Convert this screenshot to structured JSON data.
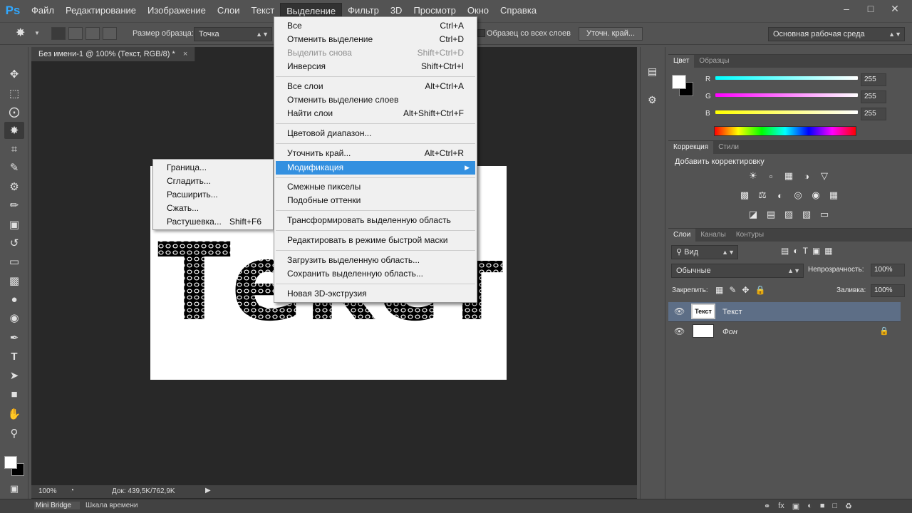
{
  "menubar": {
    "logo": "Ps",
    "items": [
      "Файл",
      "Редактирование",
      "Изображение",
      "Слои",
      "Текст",
      "Выделение",
      "Фильтр",
      "3D",
      "Просмотр",
      "Окно",
      "Справка"
    ]
  },
  "optbar": {
    "sample_size_label": "Размер образца:",
    "sample_size_value": "Точка",
    "all_layers_label": "Образец со всех слоев",
    "refine_button": "Уточн. край...",
    "workspace": "Основная рабочая среда"
  },
  "document": {
    "tab_title": "Без имени-1 @ 100% (Текст, RGB/8) *",
    "canvas_text": "Текст"
  },
  "statusbar": {
    "zoom": "100%",
    "doc_info": "Док: 439,5K/762,9K"
  },
  "bottombar": {
    "tabs": [
      "Mini Bridge",
      "Шкала времени"
    ]
  },
  "color_panel": {
    "tabs": [
      "Цвет",
      "Образцы"
    ],
    "channels": [
      {
        "label": "R",
        "value": "255"
      },
      {
        "label": "G",
        "value": "255"
      },
      {
        "label": "B",
        "value": "255"
      }
    ],
    "colors": {
      "r": "#00e5ff",
      "g": "#ff00ff",
      "b": "#ffff00"
    }
  },
  "adjustments_panel": {
    "tabs": [
      "Коррекция",
      "Стили"
    ],
    "title": "Добавить корректировку"
  },
  "layers_panel": {
    "tabs": [
      "Слои",
      "Каналы",
      "Контуры"
    ],
    "filter_label": "Вид",
    "blend_mode": "Обычные",
    "opacity_label": "Непрозрачность:",
    "opacity_value": "100%",
    "lock_label": "Закрепить:",
    "fill_label": "Заливка:",
    "fill_value": "100%",
    "layers": [
      {
        "name": "Текст",
        "thumb": "Текст"
      },
      {
        "name": "Фон"
      }
    ]
  },
  "select_menu": {
    "items": [
      {
        "label": "Все",
        "shortcut": "Ctrl+A"
      },
      {
        "label": "Отменить выделение",
        "shortcut": "Ctrl+D"
      },
      {
        "label": "Выделить снова",
        "shortcut": "Shift+Ctrl+D"
      },
      {
        "label": "Инверсия",
        "shortcut": "Shift+Ctrl+I"
      },
      {
        "label": "Все слои",
        "shortcut": "Alt+Ctrl+A"
      },
      {
        "label": "Отменить выделение слоев",
        "shortcut": ""
      },
      {
        "label": "Найти слои",
        "shortcut": "Alt+Shift+Ctrl+F"
      },
      {
        "label": "Цветовой диапазон...",
        "shortcut": ""
      },
      {
        "label": "Уточнить край...",
        "shortcut": "Alt+Ctrl+R"
      },
      {
        "label": "Модификация",
        "shortcut": ""
      },
      {
        "label": "Смежные пикселы",
        "shortcut": ""
      },
      {
        "label": "Подобные оттенки",
        "shortcut": ""
      },
      {
        "label": "Трансформировать выделенную область",
        "shortcut": ""
      },
      {
        "label": "Редактировать в режиме быстрой маски",
        "shortcut": ""
      },
      {
        "label": "Загрузить выделенную область...",
        "shortcut": ""
      },
      {
        "label": "Сохранить выделенную область...",
        "shortcut": ""
      },
      {
        "label": "Новая 3D-экструзия",
        "shortcut": ""
      }
    ]
  },
  "modify_submenu": {
    "items": [
      {
        "label": "Граница...",
        "shortcut": ""
      },
      {
        "label": "Сгладить...",
        "shortcut": ""
      },
      {
        "label": "Расширить...",
        "shortcut": ""
      },
      {
        "label": "Сжать...",
        "shortcut": ""
      },
      {
        "label": "Растушевка...",
        "shortcut": "Shift+F6"
      }
    ]
  }
}
